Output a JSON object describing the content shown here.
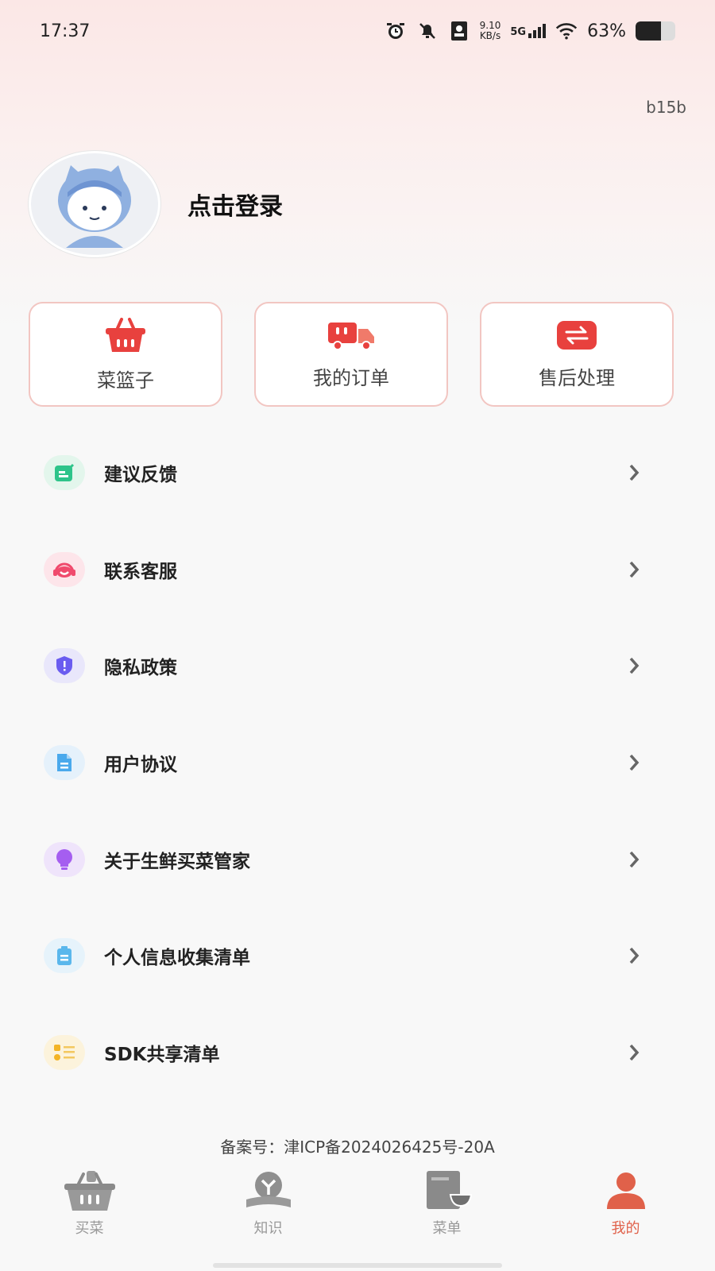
{
  "status_bar": {
    "time": "17:37",
    "net_speed_value": "9.10",
    "net_speed_unit": "KB/s",
    "network": "5G",
    "battery_text": "63%",
    "battery_level": 0.63
  },
  "header": {
    "version": "b15b"
  },
  "profile": {
    "login_text": "点击登录",
    "avatar_icon": "avatar-placeholder"
  },
  "quick_actions": [
    {
      "label": "菜篮子",
      "icon": "basket-icon",
      "color": "#e8413e"
    },
    {
      "label": "我的订单",
      "icon": "truck-icon",
      "color": "#e8413e"
    },
    {
      "label": "售后处理",
      "icon": "exchange-icon",
      "color": "#e8413e"
    }
  ],
  "menu": [
    {
      "label": "建议反馈",
      "icon": "feedback-icon",
      "color": "#2ec48a",
      "bg": "#e3f6ec"
    },
    {
      "label": "联系客服",
      "icon": "headset-icon",
      "color": "#f04a6d",
      "bg": "#fde5ea"
    },
    {
      "label": "隐私政策",
      "icon": "shield-icon",
      "color": "#6a5cf0",
      "bg": "#e9e7fb"
    },
    {
      "label": "用户协议",
      "icon": "document-icon",
      "color": "#4aa9ec",
      "bg": "#e5f1fb"
    },
    {
      "label": "关于生鲜买菜管家",
      "icon": "lightbulb-icon",
      "color": "#a55ef0",
      "bg": "#efe4fb"
    },
    {
      "label": "个人信息收集清单",
      "icon": "clipboard-icon",
      "color": "#5ab7ec",
      "bg": "#e6f3fb"
    },
    {
      "label": "SDK共享清单",
      "icon": "list-icon",
      "color": "#f3b427",
      "bg": "#fcf3dc"
    }
  ],
  "footer": {
    "icp": "备案号：津ICP备2024026425号-20A"
  },
  "tabbar": [
    {
      "label": "买菜",
      "icon": "market-basket-icon",
      "active": false
    },
    {
      "label": "知识",
      "icon": "knowledge-icon",
      "active": false
    },
    {
      "label": "菜单",
      "icon": "menu-book-icon",
      "active": false
    },
    {
      "label": "我的",
      "icon": "person-icon",
      "active": true
    }
  ],
  "colors": {
    "accent": "#e0614a",
    "card_border": "#f2c6c2"
  }
}
